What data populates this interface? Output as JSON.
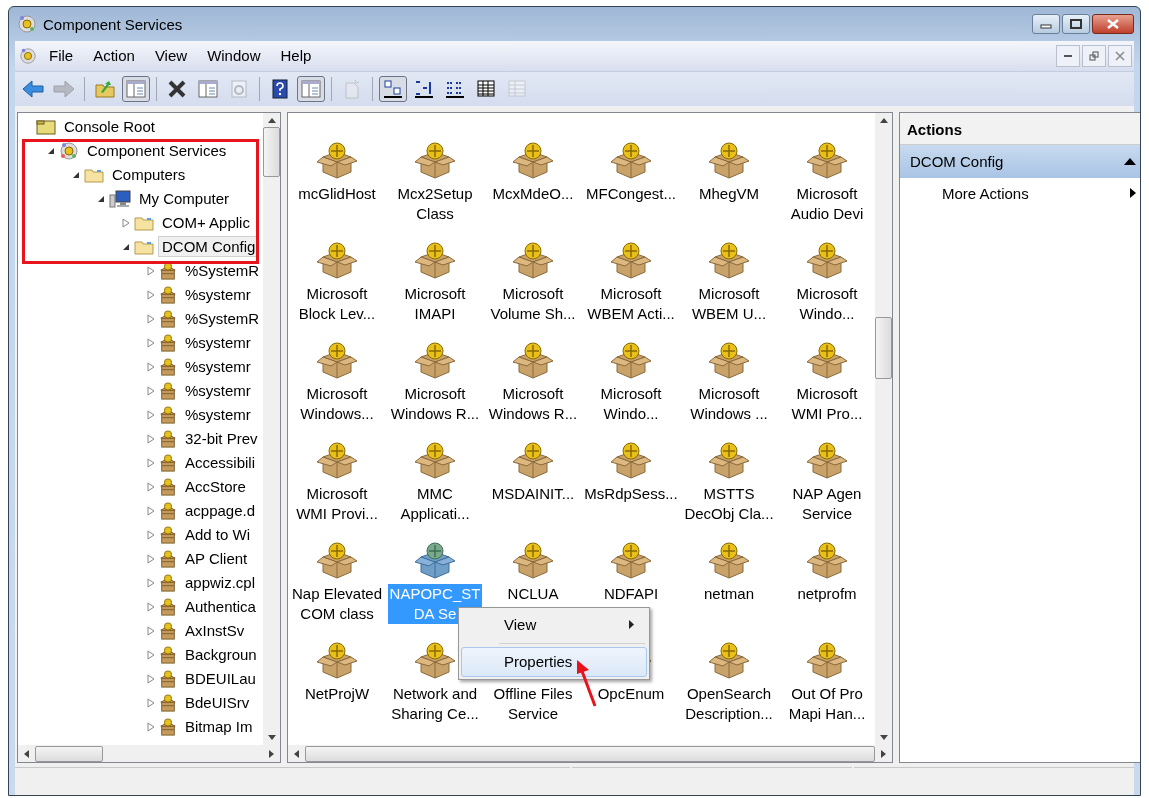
{
  "window": {
    "title": "Component Services"
  },
  "menu": [
    "File",
    "Action",
    "View",
    "Window",
    "Help"
  ],
  "toolbar": [
    {
      "kind": "back",
      "pressed": false,
      "disabled": false
    },
    {
      "kind": "forward",
      "pressed": false,
      "disabled": true
    },
    {
      "kind": "sep"
    },
    {
      "kind": "up",
      "pressed": false,
      "disabled": false
    },
    {
      "kind": "console-tree",
      "pressed": true,
      "disabled": false
    },
    {
      "kind": "sep"
    },
    {
      "kind": "delete",
      "pressed": false,
      "disabled": false
    },
    {
      "kind": "properties",
      "pressed": false,
      "disabled": false
    },
    {
      "kind": "refresh",
      "pressed": false,
      "disabled": true
    },
    {
      "kind": "sep"
    },
    {
      "kind": "help",
      "pressed": false,
      "disabled": false
    },
    {
      "kind": "action-pane",
      "pressed": true,
      "disabled": false
    },
    {
      "kind": "sep"
    },
    {
      "kind": "new-window",
      "pressed": false,
      "disabled": true
    },
    {
      "kind": "sep"
    },
    {
      "kind": "large-icons",
      "pressed": true,
      "disabled": false
    },
    {
      "kind": "small-icons",
      "pressed": false,
      "disabled": false
    },
    {
      "kind": "list",
      "pressed": false,
      "disabled": false
    },
    {
      "kind": "details",
      "pressed": false,
      "disabled": false
    },
    {
      "kind": "custom",
      "pressed": false,
      "disabled": true
    }
  ],
  "tree": [
    {
      "label": "Console Root",
      "kind": "root",
      "expanded": true,
      "selected": false,
      "children": [
        {
          "label": "Component Services",
          "kind": "services",
          "expanded": true,
          "selected": false,
          "children": [
            {
              "label": "Computers",
              "kind": "folder",
              "expanded": true,
              "selected": false,
              "children": [
                {
                  "label": "My Computer",
                  "kind": "computer",
                  "expanded": true,
                  "selected": false,
                  "children": [
                    {
                      "label": "COM+ Applic",
                      "kind": "folder",
                      "expanded": false,
                      "selected": false
                    },
                    {
                      "label": "DCOM Config",
                      "kind": "folder",
                      "expanded": true,
                      "selected": true,
                      "children": [
                        {
                          "label": "%SystemR",
                          "kind": "component",
                          "expanded": false,
                          "selected": false
                        },
                        {
                          "label": "%systemr",
                          "kind": "component",
                          "expanded": false,
                          "selected": false
                        },
                        {
                          "label": "%SystemR",
                          "kind": "component",
                          "expanded": false,
                          "selected": false
                        },
                        {
                          "label": "%systemr",
                          "kind": "component",
                          "expanded": false,
                          "selected": false
                        },
                        {
                          "label": "%systemr",
                          "kind": "component",
                          "expanded": false,
                          "selected": false
                        },
                        {
                          "label": "%systemr",
                          "kind": "component",
                          "expanded": false,
                          "selected": false
                        },
                        {
                          "label": "%systemr",
                          "kind": "component",
                          "expanded": false,
                          "selected": false
                        },
                        {
                          "label": "32-bit Prev",
                          "kind": "component",
                          "expanded": false,
                          "selected": false
                        },
                        {
                          "label": "Accessibili",
                          "kind": "component",
                          "expanded": false,
                          "selected": false
                        },
                        {
                          "label": "AccStore",
                          "kind": "component",
                          "expanded": false,
                          "selected": false
                        },
                        {
                          "label": "acppage.d",
                          "kind": "component",
                          "expanded": false,
                          "selected": false
                        },
                        {
                          "label": "Add to Wi",
                          "kind": "component",
                          "expanded": false,
                          "selected": false
                        },
                        {
                          "label": "AP Client",
                          "kind": "component",
                          "expanded": false,
                          "selected": false
                        },
                        {
                          "label": "appwiz.cpl",
                          "kind": "component",
                          "expanded": false,
                          "selected": false
                        },
                        {
                          "label": "Authentica",
                          "kind": "component",
                          "expanded": false,
                          "selected": false
                        },
                        {
                          "label": "AxInstSv",
                          "kind": "component",
                          "expanded": false,
                          "selected": false
                        },
                        {
                          "label": "Backgroun",
                          "kind": "component",
                          "expanded": false,
                          "selected": false
                        },
                        {
                          "label": "BDEUILau",
                          "kind": "component",
                          "expanded": false,
                          "selected": false
                        },
                        {
                          "label": "BdeUISrv",
                          "kind": "component",
                          "expanded": false,
                          "selected": false
                        },
                        {
                          "label": "Bitmap Im",
                          "kind": "component",
                          "expanded": false,
                          "selected": false
                        }
                      ]
                    }
                  ]
                }
              ]
            }
          ]
        }
      ]
    }
  ],
  "items": [
    {
      "lines": [
        "mcGlidHost"
      ],
      "selected": false
    },
    {
      "lines": [
        "Mcx2Setup",
        "Class"
      ],
      "selected": false
    },
    {
      "lines": [
        "McxMdeO..."
      ],
      "selected": false
    },
    {
      "lines": [
        "MFCongest..."
      ],
      "selected": false
    },
    {
      "lines": [
        "MhegVM"
      ],
      "selected": false
    },
    {
      "lines": [
        "Microsoft",
        "Audio Devi"
      ],
      "selected": false
    },
    {
      "lines": [
        "Microsoft",
        "Block Lev..."
      ],
      "selected": false
    },
    {
      "lines": [
        "Microsoft",
        "IMAPI"
      ],
      "selected": false
    },
    {
      "lines": [
        "Microsoft",
        "Volume Sh..."
      ],
      "selected": false
    },
    {
      "lines": [
        "Microsoft",
        "WBEM Acti..."
      ],
      "selected": false
    },
    {
      "lines": [
        "Microsoft",
        "WBEM U..."
      ],
      "selected": false
    },
    {
      "lines": [
        "Microsoft",
        "Windo..."
      ],
      "selected": false
    },
    {
      "lines": [
        "Microsoft",
        "Windows..."
      ],
      "selected": false
    },
    {
      "lines": [
        "Microsoft",
        "Windows R..."
      ],
      "selected": false
    },
    {
      "lines": [
        "Microsoft",
        "Windows R..."
      ],
      "selected": false
    },
    {
      "lines": [
        "Microsoft",
        "Windo..."
      ],
      "selected": false
    },
    {
      "lines": [
        "Microsoft",
        "Windows ..."
      ],
      "selected": false
    },
    {
      "lines": [
        "Microsoft",
        "WMI Pro..."
      ],
      "selected": false
    },
    {
      "lines": [
        "Microsoft",
        "WMI Provi..."
      ],
      "selected": false
    },
    {
      "lines": [
        "MMC",
        "Applicati..."
      ],
      "selected": false
    },
    {
      "lines": [
        "MSDAINIT..."
      ],
      "selected": false
    },
    {
      "lines": [
        "MsRdpSess..."
      ],
      "selected": false
    },
    {
      "lines": [
        "MSTTS",
        "DecObj Cla..."
      ],
      "selected": false
    },
    {
      "lines": [
        "NAP Agen",
        "Service"
      ],
      "selected": false
    },
    {
      "lines": [
        "Nap Elevated",
        "COM class"
      ],
      "selected": false
    },
    {
      "lines": [
        "NAPOPC_ST",
        "DA Se"
      ],
      "selected": true
    },
    {
      "lines": [
        "NCLUA"
      ],
      "selected": false
    },
    {
      "lines": [
        "NDFAPI"
      ],
      "selected": false
    },
    {
      "lines": [
        "netman"
      ],
      "selected": false
    },
    {
      "lines": [
        "netprofm"
      ],
      "selected": false
    },
    {
      "lines": [
        "NetProjW"
      ],
      "selected": false
    },
    {
      "lines": [
        "Network and",
        "Sharing Ce..."
      ],
      "selected": false
    },
    {
      "lines": [
        "Offline Files",
        "Service"
      ],
      "selected": false
    },
    {
      "lines": [
        "OpcEnum"
      ],
      "selected": false
    },
    {
      "lines": [
        "OpenSearch",
        "Description..."
      ],
      "selected": false
    },
    {
      "lines": [
        "Out Of Pro",
        "Mapi Han..."
      ],
      "selected": false
    }
  ],
  "context_menu": [
    {
      "label": "View",
      "kind": "submenu",
      "selected": false
    },
    {
      "kind": "separator"
    },
    {
      "label": "Properties",
      "kind": "item",
      "selected": true
    }
  ],
  "actions": {
    "title": "Actions",
    "sections": [
      {
        "title": "DCOM Config",
        "expanded": true,
        "items": [
          {
            "label": "More Actions",
            "kind": "submenu"
          }
        ]
      }
    ]
  }
}
